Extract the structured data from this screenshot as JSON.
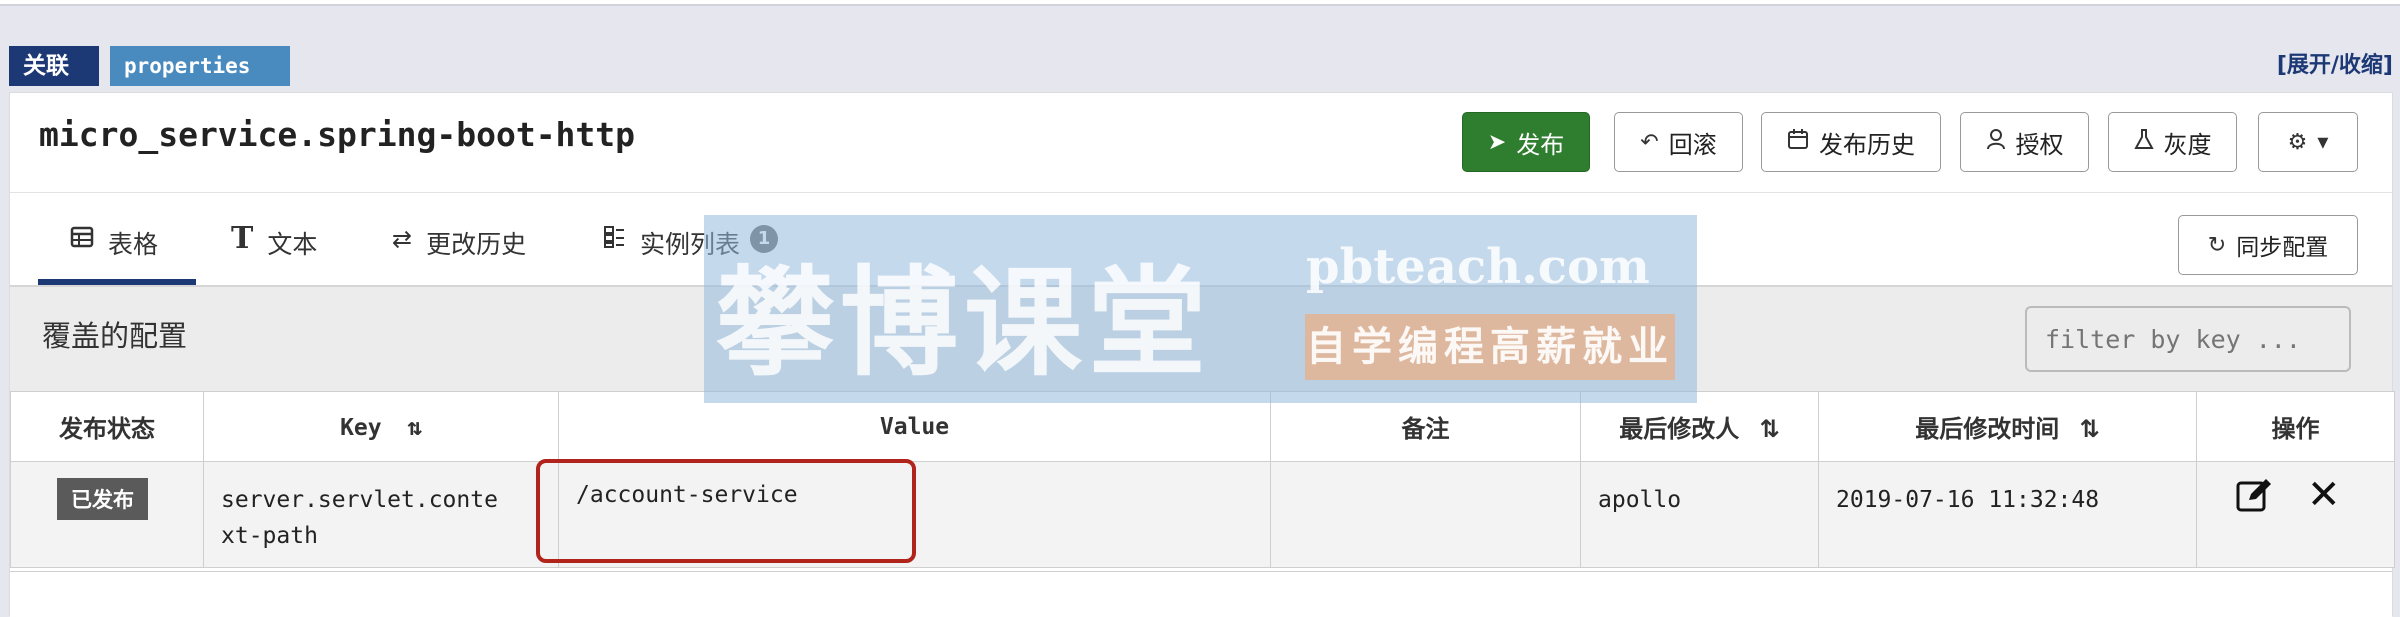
{
  "tags": {
    "association": "关联",
    "format": "properties",
    "expand_collapse": "[展开/收缩]"
  },
  "namespace": {
    "title": "micro_service.spring-boot-http"
  },
  "toolbar": {
    "release": "发布",
    "rollback": "回滚",
    "release_history": "发布历史",
    "authorize": "授权",
    "gray": "灰度",
    "settings_icon": "gear-icon"
  },
  "tabs": [
    {
      "label": "表格",
      "icon": "table-icon",
      "active": true
    },
    {
      "label": "文本",
      "icon": "text-icon"
    },
    {
      "label": "更改历史",
      "icon": "history-icon"
    },
    {
      "label": "实例列表",
      "icon": "instances-icon",
      "badge": "1"
    }
  ],
  "sync_button": "同步配置",
  "section": {
    "title": "覆盖的配置",
    "filter_placeholder": "filter by key ..."
  },
  "table": {
    "headers": {
      "status": "发布状态",
      "key": "Key",
      "value": "Value",
      "comment": "备注",
      "modifier": "最后修改人",
      "modified_time": "最后修改时间",
      "actions": "操作"
    },
    "sort_icon": "⇅",
    "rows": [
      {
        "status": "已发布",
        "key": "server.servlet.conte\nxt-path",
        "value": "/account-service",
        "comment": "",
        "modifier": "apollo",
        "modified_time": "2019-07-16 11:32:48"
      }
    ]
  },
  "watermark": {
    "brand": "攀博课堂",
    "domain": "pbteach.com",
    "slogan": "自学编程高薪就业"
  },
  "colors": {
    "primary_navy": "#1c3875",
    "release_green": "#2f7d2f",
    "highlight_red": "#b0241c",
    "tag_blue": "#4a8bbf"
  }
}
